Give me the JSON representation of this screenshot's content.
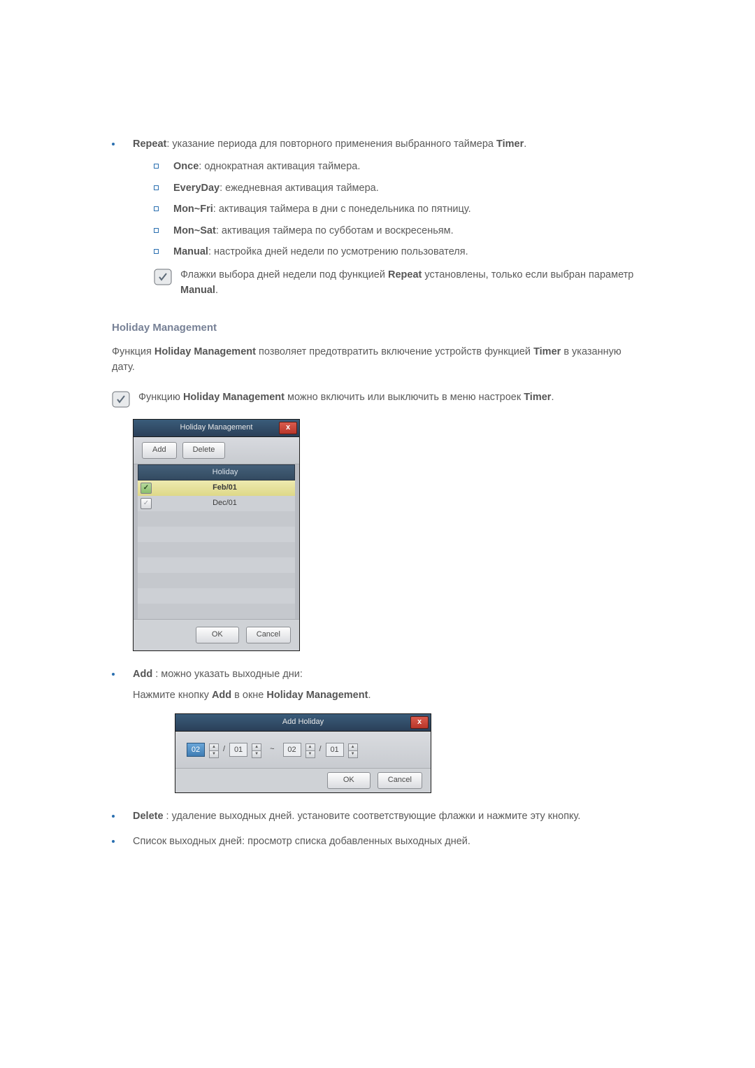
{
  "repeat": {
    "label": "Repeat",
    "desc_prefix": ": указание периода для повторного применения выбранного таймера ",
    "desc_bold_suffix": "Timer",
    "desc_end": ".",
    "options": [
      {
        "label": "Once",
        "desc": ": однократная активация таймера."
      },
      {
        "label": "EveryDay",
        "desc": ": ежедневная активация таймера."
      },
      {
        "label": "Mon~Fri",
        "desc": ": активация таймера в дни с понедельника по пятницу."
      },
      {
        "label": "Mon~Sat",
        "desc": ": активация таймера по субботам и воскресеньям."
      },
      {
        "label": "Manual",
        "desc": ": настройка дней недели по усмотрению пользователя."
      }
    ],
    "note_pre": "Флажки выбора дней недели под функцией ",
    "note_bold1": "Repeat",
    "note_mid": " установлены, только если выбран параметр ",
    "note_bold2": "Manual",
    "note_end": "."
  },
  "holiday_section": {
    "heading": "Holiday Management",
    "p1_pre": "Функция ",
    "p1_b1": "Holiday Management",
    "p1_mid": " позволяет предотвратить включение устройств функцией ",
    "p1_b2": "Timer",
    "p1_end": " в указанную дату.",
    "note_pre": "Функцию ",
    "note_b1": "Holiday Management",
    "note_mid": " можно включить или выключить в меню настроек ",
    "note_b2": "Timer",
    "note_end": "."
  },
  "holiday_dialog": {
    "title": "Holiday Management",
    "close": "x",
    "add_btn": "Add",
    "delete_btn": "Delete",
    "col_header": "Holiday",
    "rows": [
      {
        "checked": true,
        "selected": true,
        "value": "Feb/01"
      },
      {
        "checked": false,
        "selected": false,
        "value": "Dec/01"
      }
    ],
    "ok": "OK",
    "cancel": "Cancel"
  },
  "add_item": {
    "label": "Add",
    "desc": " : можно указать выходные дни:",
    "p_pre": "Нажмите кнопку ",
    "p_b1": "Add",
    "p_mid": " в окне ",
    "p_b2": "Holiday Management",
    "p_end": "."
  },
  "add_dialog": {
    "title": "Add Holiday",
    "close": "x",
    "month1": "02",
    "day1": "01",
    "sep_slash": "/",
    "sep_tilde": "~",
    "month2": "02",
    "day2": "01",
    "ok": "OK",
    "cancel": "Cancel"
  },
  "delete_item": {
    "label": "Delete",
    "desc": " : удаление выходных дней. установите соответствующие флажки и нажмите эту кнопку."
  },
  "list_item": {
    "desc": "Список выходных дней: просмотр списка добавленных выходных дней."
  }
}
